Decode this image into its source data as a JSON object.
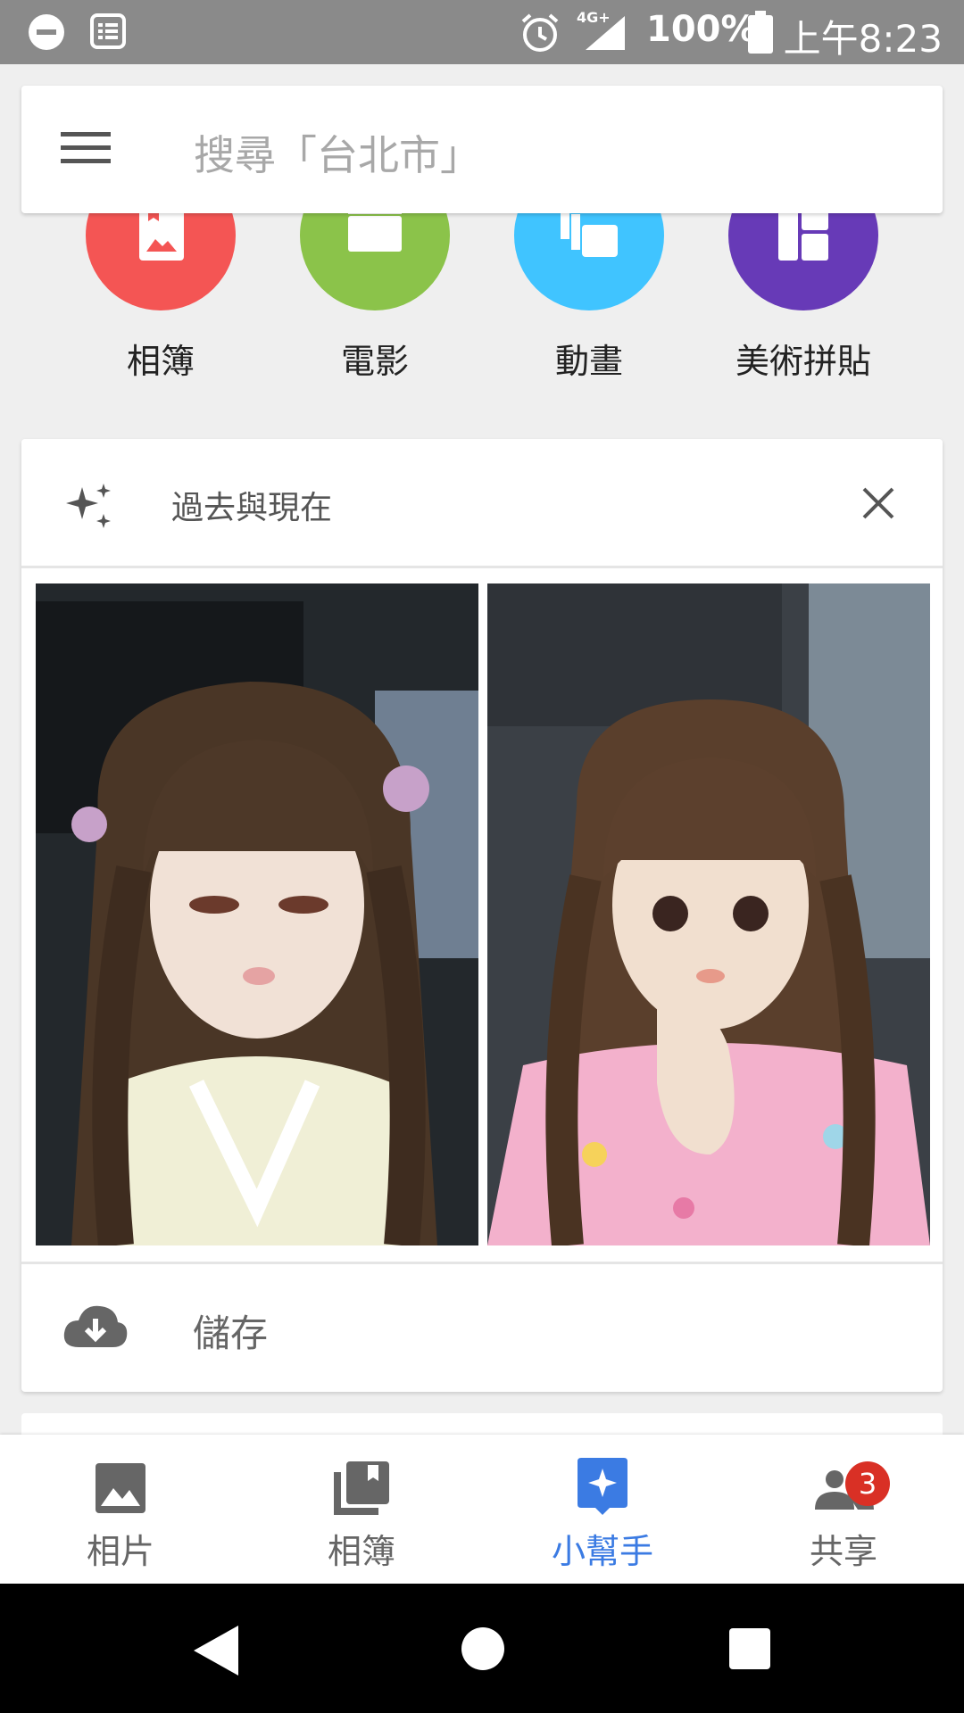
{
  "status_bar": {
    "time": "上午8:23",
    "battery": "100%",
    "network": "4G+",
    "icons": [
      "do-not-disturb-icon",
      "notes-icon",
      "alarm-icon",
      "signal-icon",
      "battery-icon"
    ]
  },
  "search": {
    "placeholder": "搜尋「台北市」",
    "menu_icon": "menu-icon"
  },
  "create_items": [
    {
      "label": "相簿",
      "icon": "album-icon",
      "color": "#f45554"
    },
    {
      "label": "電影",
      "icon": "movie-icon",
      "color": "#8bc34a"
    },
    {
      "label": "動畫",
      "icon": "animation-icon",
      "color": "#40c4ff"
    },
    {
      "label": "美術拼貼",
      "icon": "collage-icon",
      "color": "#673ab7"
    }
  ],
  "assistant_card": {
    "title": "過去與現在",
    "icon": "sparkle-icon",
    "close_icon": "close-icon",
    "photos": [
      "doll-photo-then",
      "doll-photo-now"
    ],
    "action_label": "儲存",
    "action_icon": "cloud-download-icon"
  },
  "bottom_nav": {
    "items": [
      {
        "label": "相片",
        "icon": "photo-icon",
        "active": false
      },
      {
        "label": "相簿",
        "icon": "albums-icon",
        "active": false
      },
      {
        "label": "小幫手",
        "icon": "assistant-icon",
        "active": true
      },
      {
        "label": "共享",
        "icon": "people-icon",
        "active": false,
        "badge": "3"
      }
    ],
    "active_color": "#3b7be3",
    "inactive_color": "#666666"
  },
  "system_nav": {
    "icons": [
      "back-icon",
      "home-icon",
      "recents-icon"
    ]
  }
}
